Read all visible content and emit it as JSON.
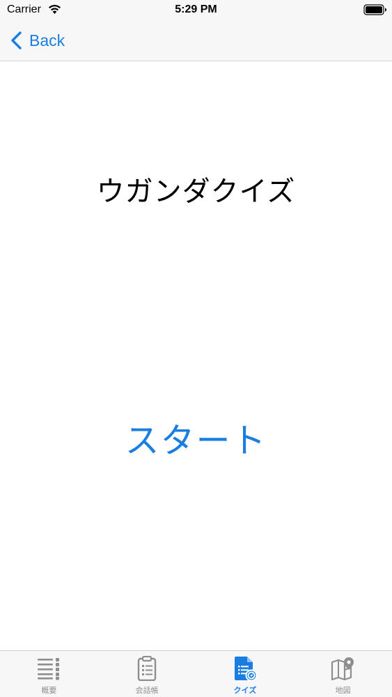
{
  "status_bar": {
    "carrier": "Carrier",
    "time": "5:29 PM"
  },
  "nav_bar": {
    "back_label": "Back"
  },
  "main": {
    "title": "ウガンダクイズ",
    "start_label": "スタート"
  },
  "tab_bar": {
    "tabs": [
      {
        "label": "概要",
        "icon": "list-icon",
        "active": false
      },
      {
        "label": "会話帳",
        "icon": "clipboard-icon",
        "active": false
      },
      {
        "label": "クイズ",
        "icon": "quiz-document-icon",
        "active": true
      },
      {
        "label": "地図",
        "icon": "map-pin-icon",
        "active": false
      }
    ]
  },
  "colors": {
    "accent": "#1a7ee0",
    "inactive": "#8e8e8e",
    "bar_background": "#f7f7f7"
  }
}
